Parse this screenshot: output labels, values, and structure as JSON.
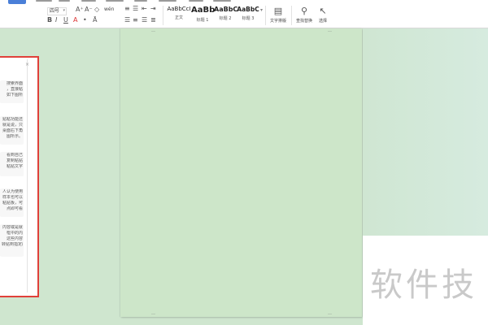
{
  "ribbon": {
    "tabs_hint": "",
    "row1": {
      "font_size": "四号",
      "labels": [
        "A⁺",
        "A⁻",
        "◇",
        "wén",
        "A",
        "•",
        "Ā"
      ]
    },
    "styles": [
      {
        "preview": "AaBbCcI",
        "caption": "正文"
      },
      {
        "preview": "AaBb",
        "caption": "标题 1"
      },
      {
        "preview": "AaBbC",
        "caption": "标题 2"
      },
      {
        "preview": "AaBbC",
        "caption": "标题 3"
      }
    ],
    "text_layout": {
      "icon": "text-layout-icon",
      "label": "文字排版"
    },
    "find_replace": {
      "icon": "magnifier-icon",
      "label": "查找替换"
    },
    "select": {
      "icon": "pointer-icon",
      "label": "选择"
    }
  },
  "side_pane": {
    "close_glyph": "×",
    "tips": [
      [
        "搜索界面",
        "，直接粘",
        "如下图所"
      ],
      [
        "贴粘功能还",
        "就是说，只",
        "桌面右下角",
        "图所示。"
      ],
      [
        "看到自己",
        "复制粘贴",
        "粘贴文字"
      ],
      [
        "人认为使用",
        "样本也可以",
        "粘贴板，可",
        "点即可看"
      ],
      [
        "内容或是就",
        "框中的内",
        "这些内容",
        "转贴到指定的"
      ]
    ]
  },
  "watermark": {
    "text": "软件技"
  },
  "colors": {
    "canvas": "#cfe6cf",
    "page": "#cde6c9",
    "highlight_border": "#e0403a",
    "accent_tab": "#4a7fd8"
  }
}
